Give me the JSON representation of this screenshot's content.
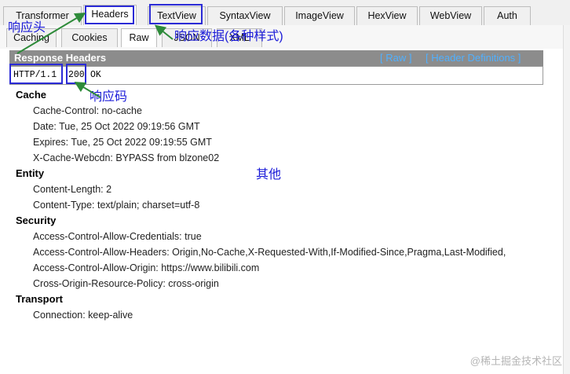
{
  "top_tabs": [
    {
      "label": "Transformer",
      "active": false
    },
    {
      "label": "Headers",
      "active": true
    },
    {
      "label": "TextView",
      "active": false
    },
    {
      "label": "SyntaxView",
      "active": false
    },
    {
      "label": "ImageView",
      "active": false
    },
    {
      "label": "HexView",
      "active": false
    },
    {
      "label": "WebView",
      "active": false
    },
    {
      "label": "Auth",
      "active": false
    }
  ],
  "second_tabs": [
    {
      "label": "Caching"
    },
    {
      "label": "Cookies"
    },
    {
      "label": "Raw"
    },
    {
      "label": "JSON"
    },
    {
      "label": "XML"
    }
  ],
  "header_bar": {
    "title": "Response Headers",
    "raw_link": "[ Raw ]",
    "definitions_link": "[ Header Definitions ]"
  },
  "status_line": {
    "protocol": "HTTP/1.1",
    "code": "200",
    "text": "OK"
  },
  "groups": [
    {
      "name": "Cache",
      "items": [
        "Cache-Control: no-cache",
        "Date: Tue, 25 Oct 2022 09:19:56 GMT",
        "Expires: Tue, 25 Oct 2022 09:19:55 GMT",
        "X-Cache-Webcdn: BYPASS from blzone02"
      ]
    },
    {
      "name": "Entity",
      "items": [
        "Content-Length: 2",
        "Content-Type: text/plain; charset=utf-8"
      ]
    },
    {
      "name": "Security",
      "items": [
        "Access-Control-Allow-Credentials: true",
        "Access-Control-Allow-Headers: Origin,No-Cache,X-Requested-With,If-Modified-Since,Pragma,Last-Modified,",
        "Access-Control-Allow-Origin: https://www.bilibili.com",
        "Cross-Origin-Resource-Policy: cross-origin"
      ]
    },
    {
      "name": "Transport",
      "items": [
        "Connection: keep-alive"
      ]
    }
  ],
  "annotations": {
    "response_head": "响应头",
    "response_data": "响应数据(各种样式)",
    "status_code": "响应码",
    "other": "其他"
  },
  "annotation_color": "#1a1ad8",
  "watermark": "@稀土掘金技术社区"
}
